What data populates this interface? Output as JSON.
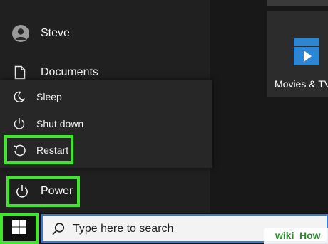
{
  "start_menu": {
    "user": {
      "name": "Steve"
    },
    "documents": {
      "label": "Documents"
    },
    "power_flyout": {
      "items": [
        {
          "label": "Sleep",
          "icon": "moon-icon"
        },
        {
          "label": "Shut down",
          "icon": "power-icon"
        },
        {
          "label": "Restart",
          "icon": "restart-icon"
        }
      ]
    },
    "power": {
      "label": "Power",
      "icon": "power-icon"
    }
  },
  "tiles": {
    "movies": {
      "label": "Movies & TV"
    }
  },
  "taskbar": {
    "search": {
      "placeholder": "Type here to search"
    }
  },
  "colors": {
    "highlight": "#3ee62c",
    "search_border": "#3a78d8",
    "tile_icon": "#2b87d6"
  },
  "watermark": {
    "part1": "wiki",
    "part2": "How"
  }
}
